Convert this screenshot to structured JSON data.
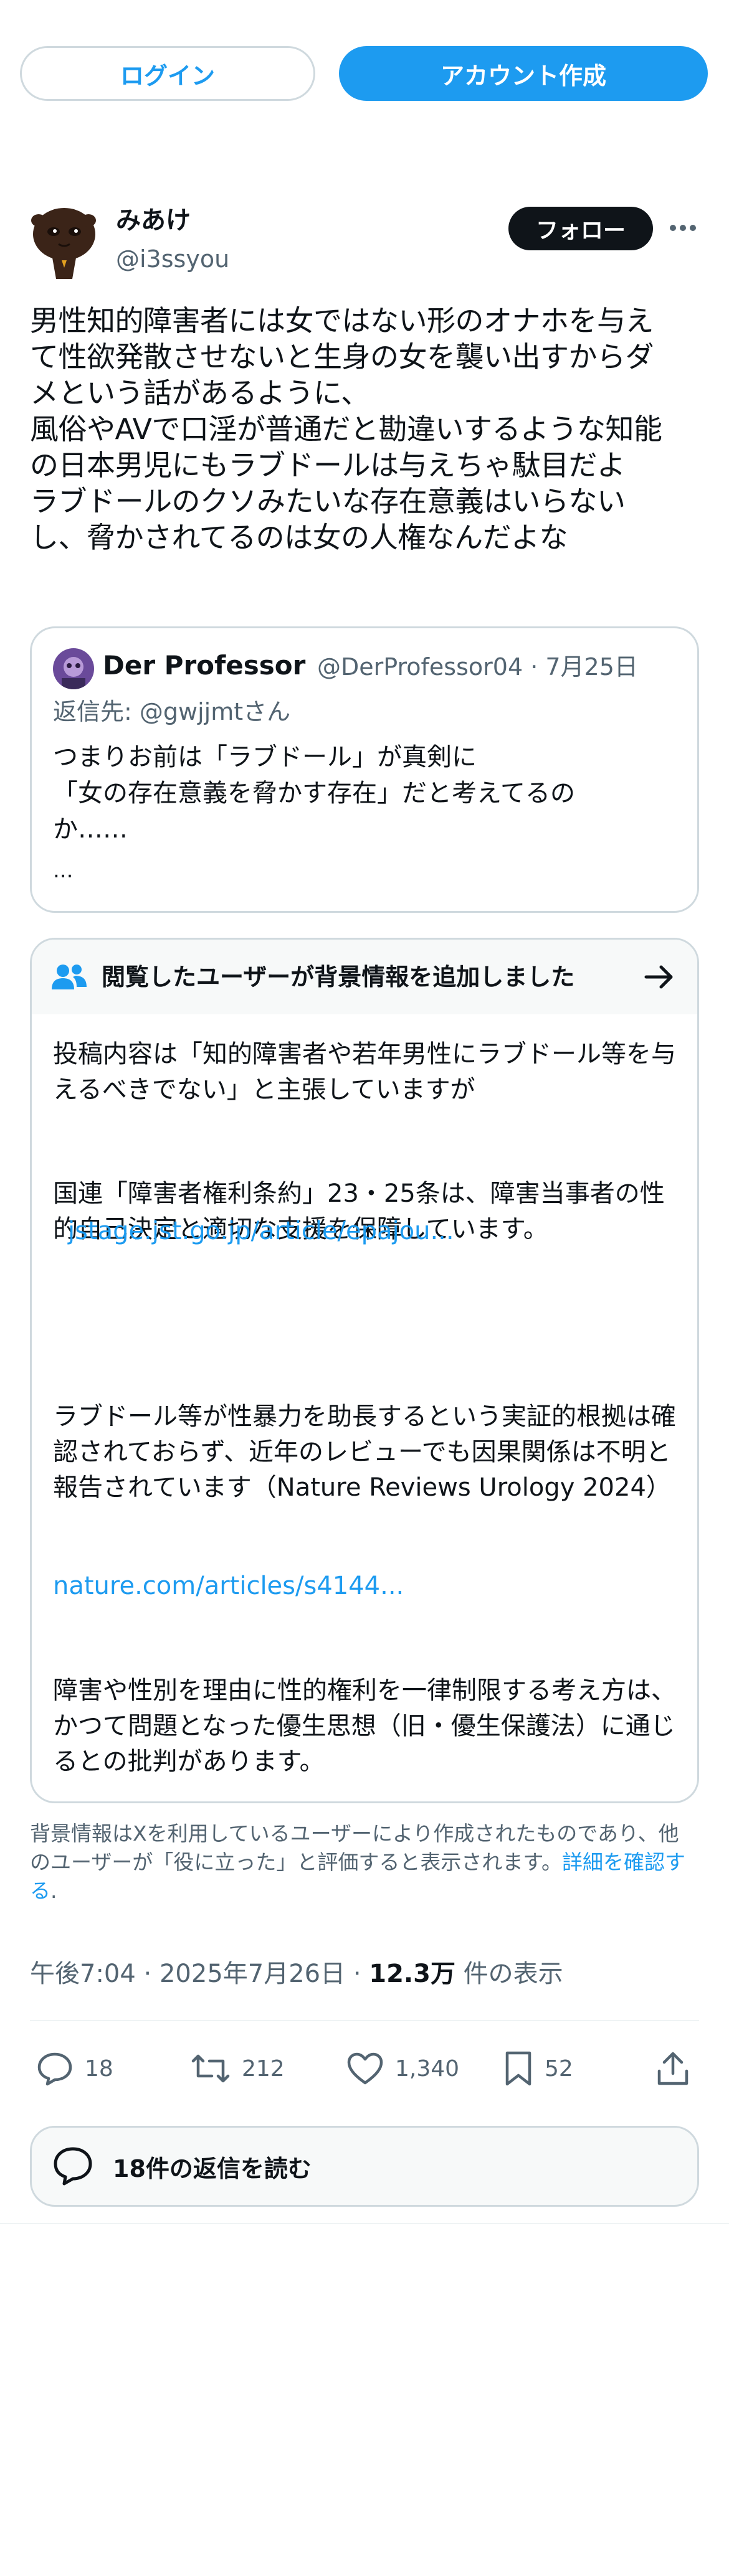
{
  "auth": {
    "login_label": "ログイン",
    "signup_label": "アカウント作成"
  },
  "tweet": {
    "author": {
      "display_name": "みあけ",
      "handle": "@i3ssyou"
    },
    "follow_label": "フォロー",
    "text": "男性知的障害者には女ではない形のオナホを与え\nて性欲発散させないと生身の女を襲い出すからダ\nメという話があるように、\n風俗やAVで口淫が普通だと勘違いするような知能\nの日本男児にもラブドールは与えちゃ駄目だよ\nラブドールのクソみたいな存在意義はいらない\nし、脅かされてるのは女の人権なんだよな",
    "timestamp": "午後7:04 · 2025年7月26日 · ",
    "views_count": "12.3万",
    "views_label": " 件の表示"
  },
  "quote": {
    "display_name": "Der Professor",
    "handle": "@DerProfessor04",
    "date": "· 7月25日",
    "reply_to": "返信先: @gwjjmtさん",
    "text": "つまりお前は「ラブドール」が真剣に\n「女の存在意義を脅かす存在」だと考えてるの\nか……",
    "ellipsis": "..."
  },
  "community_note": {
    "title": "閲覧したユーザーが背景情報を追加しました",
    "para1": "投稿内容は「知的障害者や若年男性にラブドール等を与えるべきでない」と主張していますが",
    "para2": "国連「障害者権利条約」23・25条は、障害当事者の性的自己決定と適切な支援を保障しています。",
    "link1": "jstage.jst.go.jp/article/epajou...",
    "para3": "ラブドール等が性暴力を助長するという実証的根拠は確認されておらず、近年のレビューでも因果関係は不明と報告されています（Nature Reviews Urology 2024）",
    "link2": "nature.com/articles/s4144...",
    "para4": "障害や性別を理由に性的権利を一律制限する考え方は、かつて問題となった優生思想（旧・優生保護法）に通じるとの批判があります。",
    "footer": "背景情報はXを利用しているユーザーにより作成されたものであり、他のユーザーが「役に立った」と評価すると表示されます。",
    "footer_link": "詳細を確認する",
    "footer_end": "."
  },
  "actions": {
    "replies": "18",
    "reposts": "212",
    "likes": "1,340",
    "bookmarks": "52"
  },
  "read_replies_label": "18件の返信を読む",
  "colors": {
    "accent": "#1d9bf0",
    "text": "#0f1419",
    "secondary": "#536471",
    "border": "#cfd9de"
  },
  "icons": [
    "more-icon",
    "users-icon",
    "arrow-right-icon",
    "reply-icon",
    "repost-icon",
    "like-icon",
    "bookmark-icon",
    "share-icon",
    "reply-bubble-icon"
  ]
}
